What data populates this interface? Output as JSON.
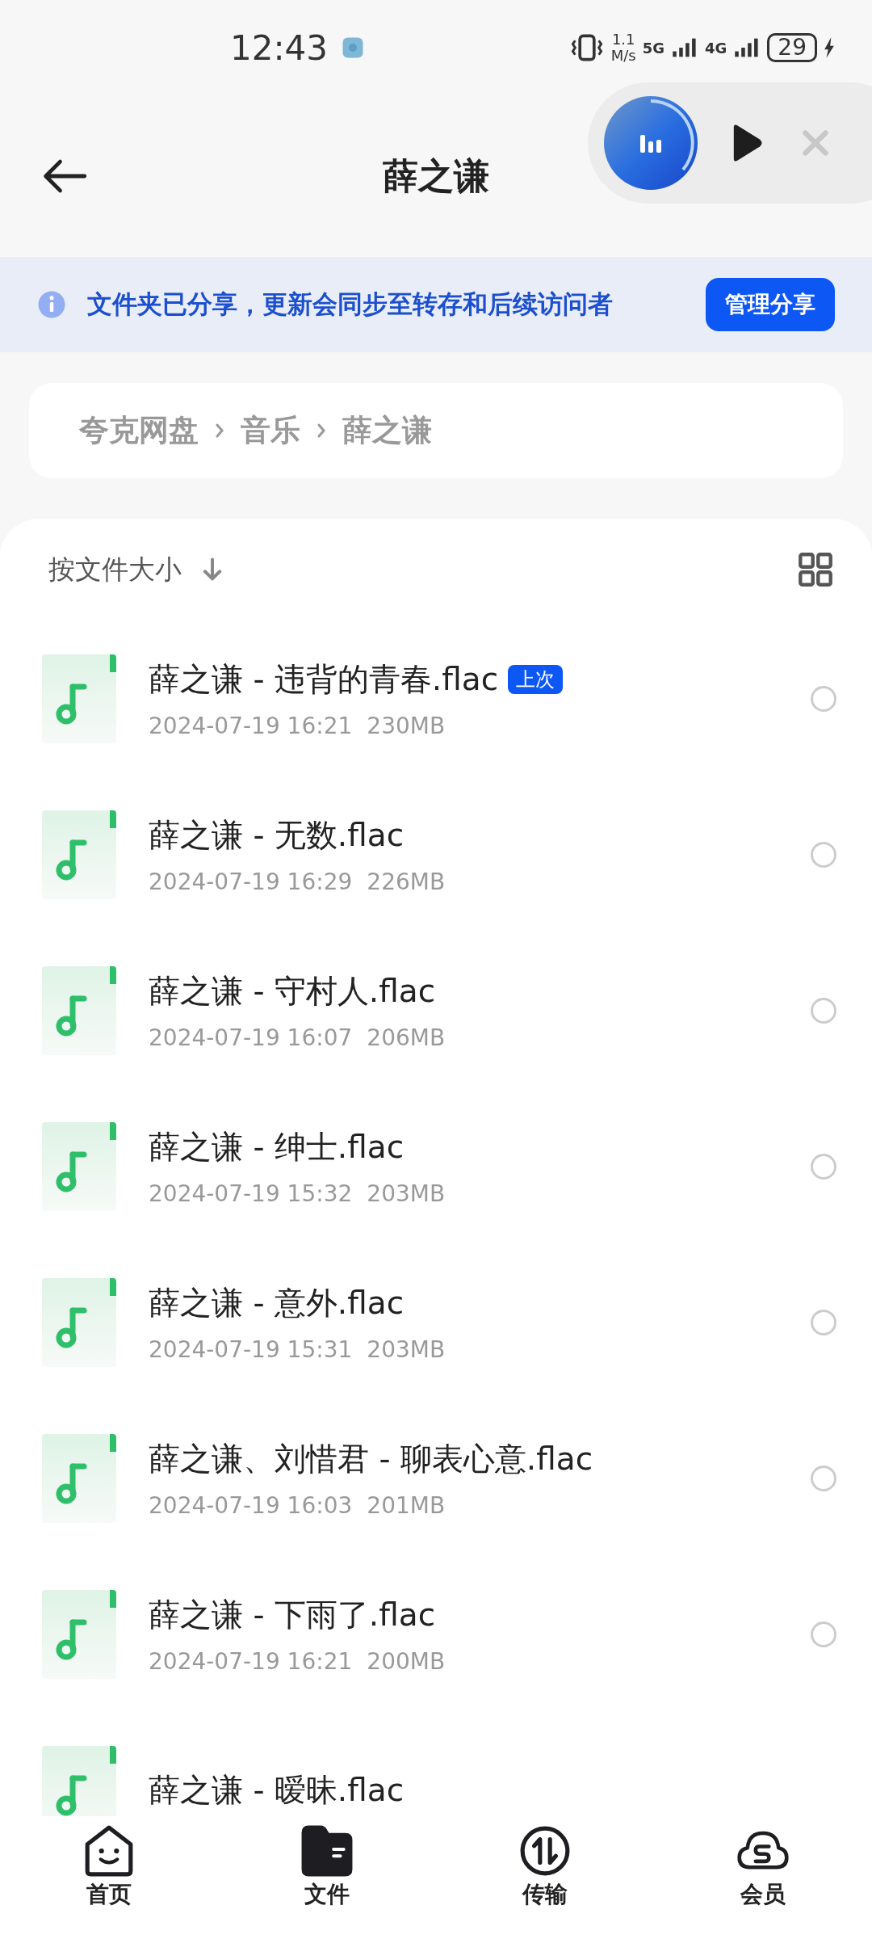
{
  "status_bar": {
    "time": "12:43",
    "speed": "1.1",
    "speed_unit": "M/s",
    "network_1": "5G",
    "network_2": "4G",
    "battery": "29"
  },
  "header": {
    "title": "薛之谦"
  },
  "mini_player": {
    "playing": false
  },
  "share_banner": {
    "text": "文件夹已分享，更新会同步至转存和后续访问者",
    "button": "管理分享"
  },
  "breadcrumb": [
    "夸克网盘",
    "音乐",
    "薛之谦"
  ],
  "sort": {
    "label": "按文件大小"
  },
  "files": [
    {
      "name": "薛之谦 - 违背的青春.flac",
      "badge": "上次",
      "date": "2024-07-19 16:21",
      "size": "230MB",
      "selected": false
    },
    {
      "name": "薛之谦 - 无数.flac",
      "date": "2024-07-19 16:29",
      "size": "226MB",
      "selected": false
    },
    {
      "name": "薛之谦 - 守村人.flac",
      "date": "2024-07-19 16:07",
      "size": "206MB",
      "selected": false
    },
    {
      "name": "薛之谦 - 绅士.flac",
      "date": "2024-07-19 15:32",
      "size": "203MB",
      "selected": false
    },
    {
      "name": "薛之谦 - 意外.flac",
      "date": "2024-07-19 15:31",
      "size": "203MB",
      "selected": false
    },
    {
      "name": "薛之谦、刘惜君 - 聊表心意.flac",
      "date": "2024-07-19 16:03",
      "size": "201MB",
      "selected": false
    },
    {
      "name": "薛之谦 - 下雨了.flac",
      "date": "2024-07-19 16:21",
      "size": "200MB",
      "selected": false
    },
    {
      "name": "薛之谦 - 暧昧.flac"
    }
  ],
  "bottom_nav": [
    {
      "label": "首页",
      "selected": false
    },
    {
      "label": "文件",
      "selected": true
    },
    {
      "label": "传输",
      "selected": false
    },
    {
      "label": "会员",
      "selected": false
    }
  ]
}
